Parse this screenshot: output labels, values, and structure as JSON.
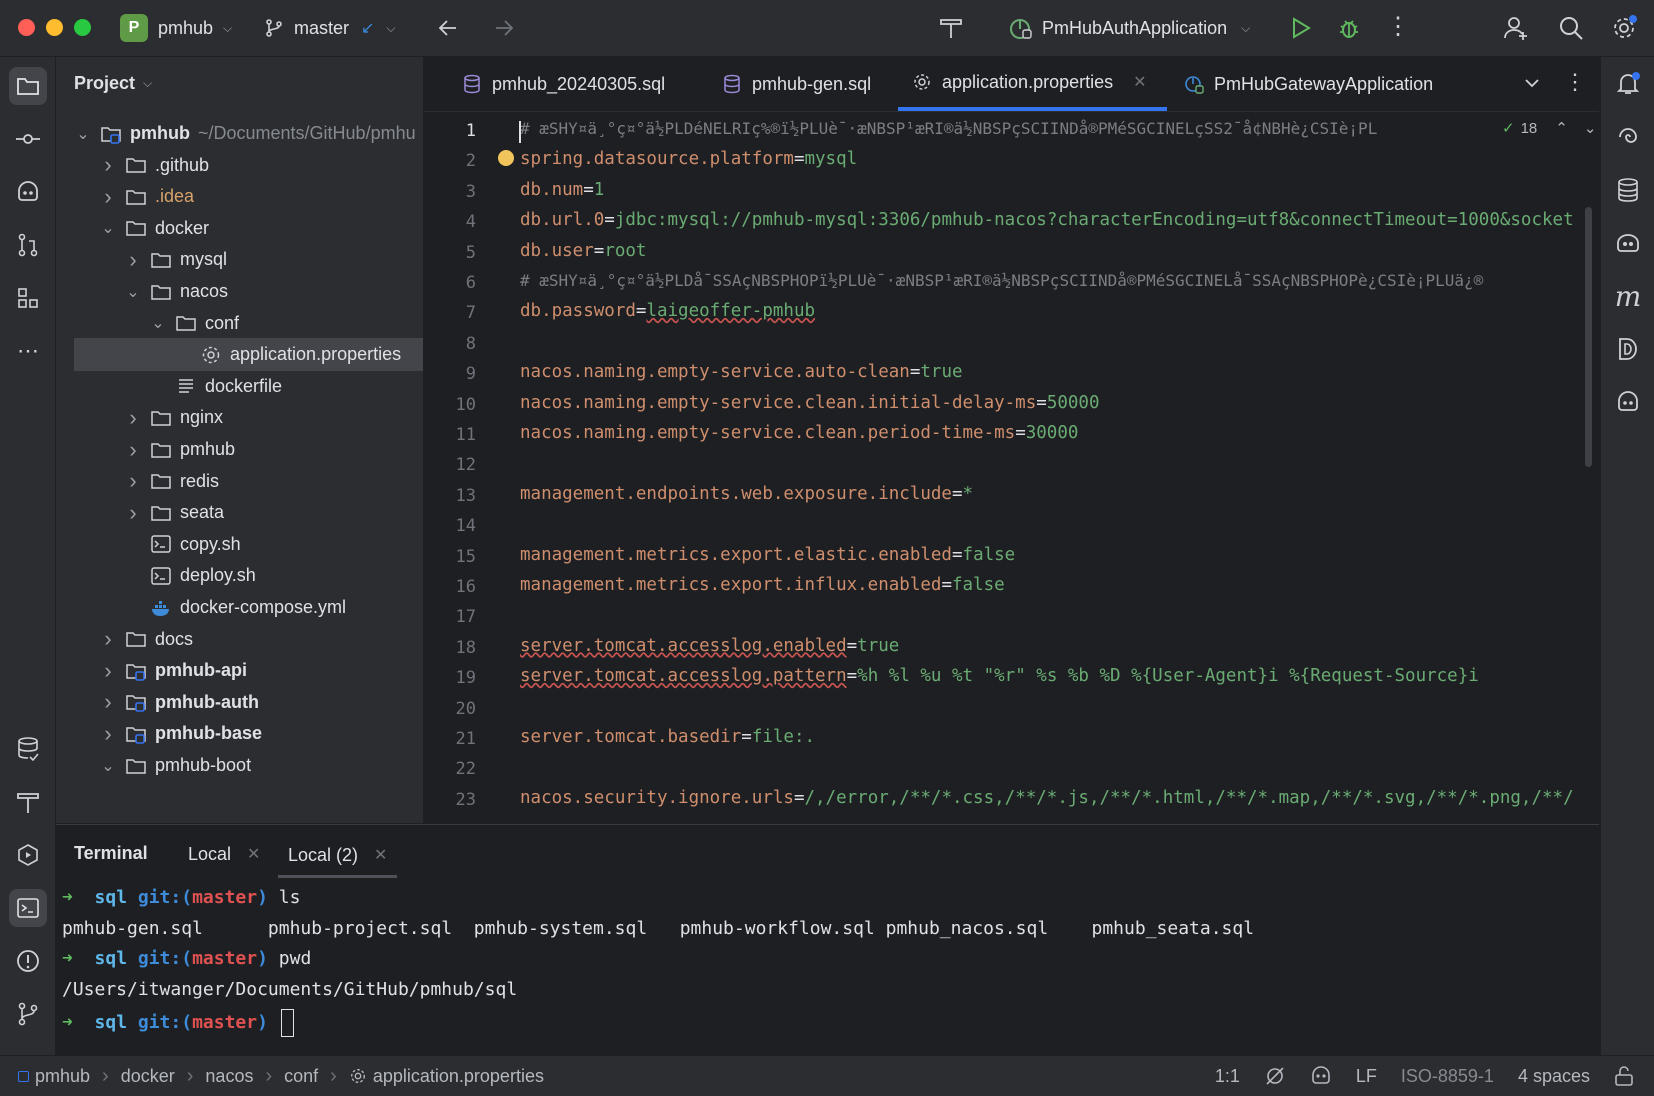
{
  "titlebar": {
    "project_letter": "P",
    "project_name": "pmhub",
    "branch": "master",
    "run_config": "PmHubAuthApplication"
  },
  "project_panel": {
    "title": "Project",
    "tree": [
      {
        "name": "pmhub",
        "hint": "~/Documents/GitHub/pmhu",
        "kind": "module-root",
        "depth": 0,
        "expanded": true
      },
      {
        "name": ".github",
        "kind": "folder",
        "depth": 1,
        "expanded": false
      },
      {
        "name": ".idea",
        "kind": "folder",
        "depth": 1,
        "expanded": false
      },
      {
        "name": "docker",
        "kind": "folder",
        "depth": 1,
        "expanded": true
      },
      {
        "name": "mysql",
        "kind": "folder",
        "depth": 2,
        "expanded": false
      },
      {
        "name": "nacos",
        "kind": "folder",
        "depth": 2,
        "expanded": true
      },
      {
        "name": "conf",
        "kind": "folder",
        "depth": 3,
        "expanded": true
      },
      {
        "name": "application.properties",
        "kind": "properties",
        "depth": 4
      },
      {
        "name": "dockerfile",
        "kind": "text",
        "depth": 3
      },
      {
        "name": "nginx",
        "kind": "folder",
        "depth": 2,
        "expanded": false
      },
      {
        "name": "pmhub",
        "kind": "folder",
        "depth": 2,
        "expanded": false
      },
      {
        "name": "redis",
        "kind": "folder",
        "depth": 2,
        "expanded": false
      },
      {
        "name": "seata",
        "kind": "folder",
        "depth": 2,
        "expanded": false
      },
      {
        "name": "copy.sh",
        "kind": "shell",
        "depth": 2
      },
      {
        "name": "deploy.sh",
        "kind": "shell",
        "depth": 2
      },
      {
        "name": "docker-compose.yml",
        "kind": "docker",
        "depth": 2
      },
      {
        "name": "docs",
        "kind": "folder",
        "depth": 1,
        "expanded": false
      },
      {
        "name": "pmhub-api",
        "kind": "module",
        "depth": 1,
        "expanded": false
      },
      {
        "name": "pmhub-auth",
        "kind": "module",
        "depth": 1,
        "expanded": false
      },
      {
        "name": "pmhub-base",
        "kind": "module",
        "depth": 1,
        "expanded": false
      },
      {
        "name": "pmhub-boot",
        "kind": "folder",
        "depth": 1,
        "expanded": true
      }
    ]
  },
  "editor": {
    "tabs": [
      {
        "label": "pmhub_20240305.sql",
        "icon": "database-icon"
      },
      {
        "label": "pmhub-gen.sql",
        "icon": "database-icon"
      },
      {
        "label": "application.properties",
        "icon": "gear-icon",
        "active": true
      },
      {
        "label": "PmHubGatewayApplication",
        "icon": "spring-class-icon"
      }
    ],
    "inspection_count": "18",
    "lines": [
      {
        "n": "1",
        "type": "comment",
        "text": "# æSHY¤ä¸°ç¤°ä½PLDéNELRIç%®ï½PLUè¯·æNBSP¹æRI®ä½NBSPçSCIINDå®PMéSGCINELçSS2¯å¢NBHè¿CSIè¡PL"
      },
      {
        "n": "2",
        "type": "kv",
        "key": "spring.datasource.platform",
        "value": "mysql"
      },
      {
        "n": "3",
        "type": "kv",
        "key": "db.num",
        "value": "1"
      },
      {
        "n": "4",
        "type": "kv",
        "key": "db.url.0",
        "value": "jdbc:mysql://pmhub-mysql:3306/pmhub-nacos?characterEncoding=utf8&connectTimeout=1000&socket"
      },
      {
        "n": "5",
        "type": "kv",
        "key": "db.user",
        "value": "root"
      },
      {
        "n": "6",
        "type": "comment",
        "text": "# æSHY¤ä¸°ç¤°ä½PLDå¯SSAçNBSPHOPï½PLUè¯·æNBSP¹æRI®ä½NBSPçSCIINDå®PMéSGCINELå¯SSAçNBSPHOPè¿CSIè¡PLUä¿®"
      },
      {
        "n": "7",
        "type": "kv",
        "key": "db.password",
        "value": "laigeoffer-pmhub"
      },
      {
        "n": "8",
        "type": "blank"
      },
      {
        "n": "9",
        "type": "kv",
        "key": "nacos.naming.empty-service.auto-clean",
        "value": "true"
      },
      {
        "n": "10",
        "type": "kv",
        "key": "nacos.naming.empty-service.clean.initial-delay-ms",
        "value": "50000"
      },
      {
        "n": "11",
        "type": "kv",
        "key": "nacos.naming.empty-service.clean.period-time-ms",
        "value": "30000"
      },
      {
        "n": "12",
        "type": "blank"
      },
      {
        "n": "13",
        "type": "kv",
        "key": "management.endpoints.web.exposure.include",
        "value": "*"
      },
      {
        "n": "14",
        "type": "blank"
      },
      {
        "n": "15",
        "type": "kv",
        "key": "management.metrics.export.elastic.enabled",
        "value": "false"
      },
      {
        "n": "16",
        "type": "kv",
        "key": "management.metrics.export.influx.enabled",
        "value": "false"
      },
      {
        "n": "17",
        "type": "blank"
      },
      {
        "n": "18",
        "type": "kv",
        "key": "server.tomcat.accesslog.enabled",
        "value": "true"
      },
      {
        "n": "19",
        "type": "kv",
        "key": "server.tomcat.accesslog.pattern",
        "value": "%h %l %u %t \"%r\" %s %b %D %{User-Agent}i %{Request-Source}i"
      },
      {
        "n": "20",
        "type": "blank"
      },
      {
        "n": "21",
        "type": "kv",
        "key": "server.tomcat.basedir",
        "value": "file:."
      },
      {
        "n": "22",
        "type": "blank"
      },
      {
        "n": "23",
        "type": "kv",
        "key": "nacos.security.ignore.urls",
        "value": "/,/error,/**/*.css,/**/*.js,/**/*.html,/**/*.map,/**/*.svg,/**/*.png,/**/"
      }
    ]
  },
  "terminal": {
    "title": "Terminal",
    "tabs": [
      {
        "label": "Local"
      },
      {
        "label": "Local (2)",
        "active": true
      }
    ],
    "prompt_dir": "sql",
    "prompt_git": "git:(",
    "prompt_branch": "master",
    "prompt_close": ")",
    "lines": [
      {
        "type": "prompt",
        "cmd": "ls"
      },
      {
        "type": "output",
        "text": "pmhub-gen.sql      pmhub-project.sql  pmhub-system.sql   pmhub-workflow.sql pmhub_nacos.sql    pmhub_seata.sql"
      },
      {
        "type": "prompt",
        "cmd": "pwd"
      },
      {
        "type": "output",
        "text": "/Users/itwanger/Documents/GitHub/pmhub/sql"
      },
      {
        "type": "prompt",
        "cmd": ""
      }
    ]
  },
  "statusbar": {
    "breadcrumbs": [
      "pmhub",
      "docker",
      "nacos",
      "conf",
      "application.properties"
    ],
    "position": "1:1",
    "line_separator": "LF",
    "encoding": "ISO-8859-1",
    "indent": "4 spaces"
  }
}
